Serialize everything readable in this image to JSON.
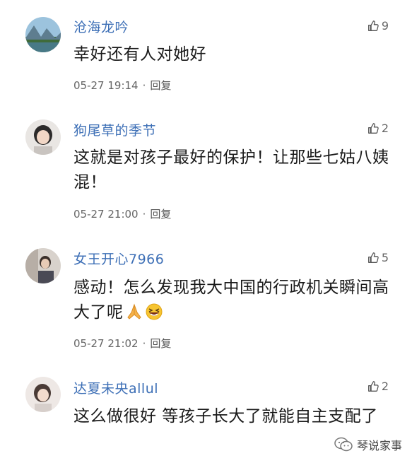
{
  "comments": [
    {
      "username": "沧海龙吟",
      "likes": "9",
      "text": "幸好还有人对她好",
      "time": "05-27 19:14",
      "reply": "回复",
      "avatar": "landscape-avatar"
    },
    {
      "username": "狗尾草的季节",
      "likes": "2",
      "text": "这就是对孩子最好的保护！让那些七姑八姨混！",
      "time": "05-27 21:00",
      "reply": "回复",
      "avatar": "girl-avatar"
    },
    {
      "username": "女王开心7966",
      "likes": "5",
      "text": "感动！怎么发现我大中国的行政机关瞬间高大了呢",
      "time": "05-27 21:02",
      "reply": "回复",
      "avatar": "person-avatar",
      "emojis": [
        "praying-hands-emoji",
        "laughing-face-emoji"
      ]
    },
    {
      "username": "达夏未央allul",
      "likes": "2",
      "text": "这么做很好 等孩子长大了就能自主支配了",
      "avatar": "girl-avatar-2"
    }
  ],
  "watermark": {
    "text": "琴说家事",
    "icon": "wechat-icon"
  },
  "colors": {
    "username": "#3d6fb6",
    "meta": "#666666",
    "text": "#1a1a1a"
  },
  "separator": "·"
}
